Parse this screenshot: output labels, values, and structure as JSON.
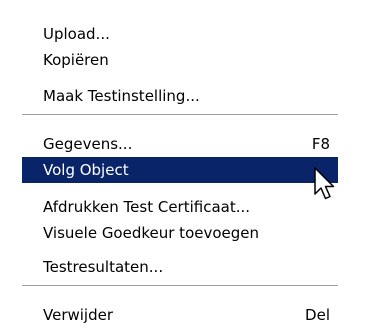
{
  "colors": {
    "highlight_bg": "#0a246a",
    "highlight_fg": "#ffffff",
    "menu_bg": "#ffffff",
    "separator": "#9f9f9f"
  },
  "menu": {
    "groups": [
      [
        {
          "label": "Upload...",
          "shortcut": ""
        },
        {
          "label": "Kopiëren",
          "shortcut": ""
        },
        {
          "label": "Maak Testinstelling...",
          "shortcut": ""
        }
      ],
      [
        {
          "label": "Gegevens...",
          "shortcut": "F8"
        },
        {
          "label": "Volg Object",
          "shortcut": "",
          "highlighted": true
        },
        {
          "label": "Afdrukken Test Certificaat...",
          "shortcut": ""
        },
        {
          "label": "Visuele Goedkeur toevoegen",
          "shortcut": ""
        },
        {
          "label": "Testresultaten...",
          "shortcut": ""
        }
      ],
      [
        {
          "label": "Verwijder",
          "shortcut": "Del"
        }
      ]
    ]
  },
  "cursor_icon": "arrow-pointer-icon"
}
